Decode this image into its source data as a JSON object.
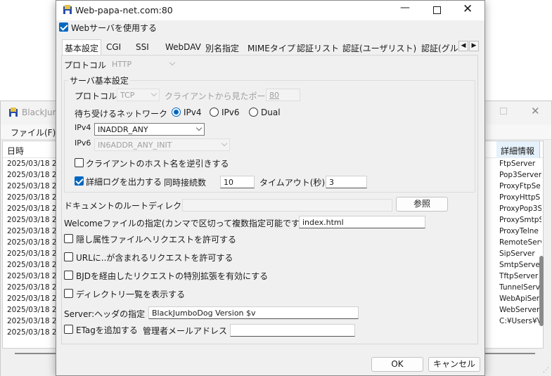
{
  "bg_window": {
    "title": "BlackJum",
    "menu_file": "ファイル(F)",
    "col_date": "日時",
    "col_detail": "詳細情報",
    "rows": [
      {
        "date": "2025/03/18 2",
        "detail": "FtpServer"
      },
      {
        "date": "2025/03/18 2",
        "detail": "Pop3Server"
      },
      {
        "date": "2025/03/18 2",
        "detail": "ProxyFtpSe"
      },
      {
        "date": "2025/03/18 2",
        "detail": "ProxyHttpS"
      },
      {
        "date": "2025/03/18 2",
        "detail": "ProxyPop3S"
      },
      {
        "date": "2025/03/18 2",
        "detail": "ProxySmtpS"
      },
      {
        "date": "2025/03/18 2",
        "detail": "ProxyTelne"
      },
      {
        "date": "2025/03/18 2",
        "detail": "RemoteServ"
      },
      {
        "date": "2025/03/18 2",
        "detail": "SipServer"
      },
      {
        "date": "2025/03/18 2",
        "detail": "SmtpServer"
      },
      {
        "date": "2025/03/18 2",
        "detail": "TftpServer"
      },
      {
        "date": "2025/03/18 2",
        "detail": "TunnelServ"
      },
      {
        "date": "2025/03/18 2",
        "detail": "WebApiServ"
      },
      {
        "date": "2025/03/18 2",
        "detail": "WebServer"
      },
      {
        "date": "2025/03/18 2",
        "detail": "C:¥Users¥V"
      },
      {
        "date": "2025/03/18 2",
        "detail": ""
      }
    ]
  },
  "dialog": {
    "title": "Web-papa-net.com:80",
    "use_web_server": "Webサーバを使用する",
    "tabs": [
      "基本設定",
      "CGI",
      "SSI",
      "WebDAV",
      "別名指定",
      "MIMEタイプ",
      "認証リスト",
      "認証(ユーザリスト)",
      "認証(グル"
    ],
    "protocol_label": "プロトコル",
    "protocol_value": "HTTP",
    "group_title": "サーバ基本設定",
    "server_protocol_label": "プロトコル",
    "server_protocol_value": "TCP",
    "client_port_label": "クライアントから見たポート",
    "client_port_value": "80",
    "listen_network_label": "待ち受けるネットワーク",
    "radio_ipv4": "IPv4",
    "radio_ipv6": "IPv6",
    "radio_dual": "Dual",
    "ipv4_label": "IPv4",
    "ipv4_value": "INADDR_ANY",
    "ipv6_label": "IPv6",
    "ipv6_value": "IN6ADDR_ANY_INIT",
    "reverse_lookup": "クライアントのホスト名を逆引きする",
    "detail_log": "詳細ログを出力する",
    "concurrent_label": "同時接続数",
    "concurrent_value": "10",
    "timeout_label": "タイムアウト(秒)",
    "timeout_value": "3",
    "doc_root_label": "ドキュメントのルートディレクトリ",
    "doc_root_value": "",
    "browse_button": "参照",
    "welcome_label": "Welcomeファイルの指定(カンマで区切って複数指定可能です)",
    "welcome_value": "index.html",
    "allow_hidden": "隠し属性ファイルへリクエストを許可する",
    "allow_dotdot": "URLに..が含まれるリクエストを許可する",
    "bjd_ext": "BJDを経由したリクエストの特別拡張を有効にする",
    "dir_listing": "ディレクトリ一覧を表示する",
    "server_header_label": "Server:ヘッダの指定",
    "server_header_value": "BlackJumboDog Version $v",
    "etag_label": "ETagを追加する",
    "admin_mail_label": "管理者メールアドレス",
    "admin_mail_value": "",
    "ok_button": "OK",
    "cancel_button": "キャンセル"
  }
}
